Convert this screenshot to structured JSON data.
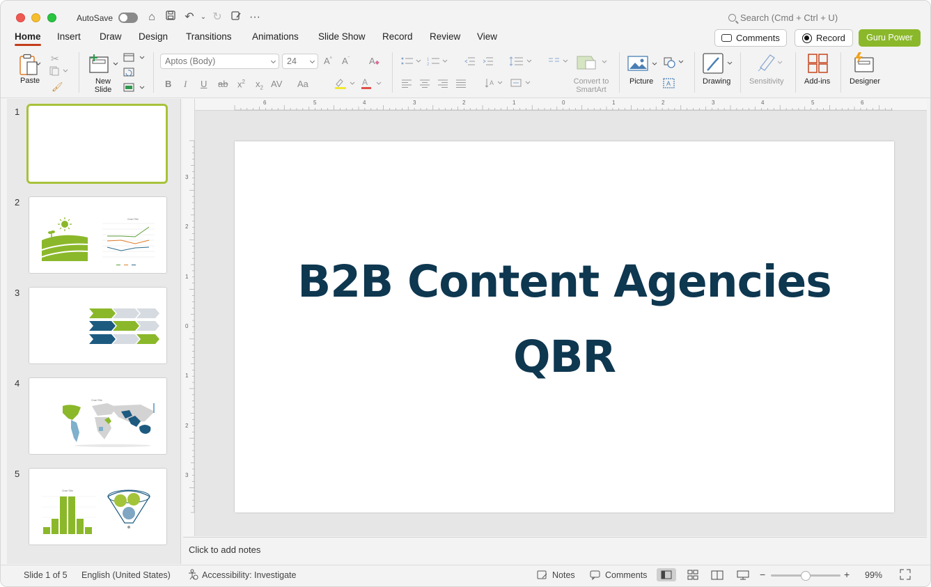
{
  "titlebar": {
    "autosave_label": "AutoSave",
    "search_placeholder": "Search (Cmd + Ctrl + U)"
  },
  "tabs": [
    "Home",
    "Insert",
    "Draw",
    "Design",
    "Transitions",
    "Animations",
    "Slide Show",
    "Record",
    "Review",
    "View"
  ],
  "active_tab": "Home",
  "actions": {
    "comments": "Comments",
    "record": "Record",
    "guru": "Guru Power"
  },
  "ribbon": {
    "paste": "Paste",
    "new_slide": "New Slide",
    "font_name": "Aptos (Body)",
    "font_size": "24",
    "convert": "Convert to SmartArt",
    "picture": "Picture",
    "drawing": "Drawing",
    "sensitivity": "Sensitivity",
    "addins": "Add-ins",
    "designer": "Designer"
  },
  "slides": [
    {
      "number": "1"
    },
    {
      "number": "2"
    },
    {
      "number": "3"
    },
    {
      "number": "4"
    },
    {
      "number": "5"
    }
  ],
  "thumb_titles": {
    "chart_title": "Chart Title"
  },
  "slide": {
    "title_line1": "B2B Content Agencies",
    "title_line2": "QBR"
  },
  "notes_placeholder": "Click to add notes",
  "ruler": {
    "horizontal": [
      "6",
      "5",
      "4",
      "3",
      "2",
      "1",
      "0",
      "1",
      "2",
      "3",
      "4",
      "5",
      "6"
    ],
    "vertical": [
      "3",
      "2",
      "1",
      "0",
      "1",
      "2",
      "3"
    ]
  },
  "status": {
    "slide_counter": "Slide 1 of 5",
    "language": "English (United States)",
    "accessibility": "Accessibility: Investigate",
    "notes": "Notes",
    "comments": "Comments",
    "zoom": "99%"
  },
  "zoom_level": 0.99,
  "colors": {
    "accent_green": "#8bb82a",
    "title_navy": "#0e3750",
    "tab_underline": "#c43e1c",
    "selection_border": "#a8c23a"
  }
}
